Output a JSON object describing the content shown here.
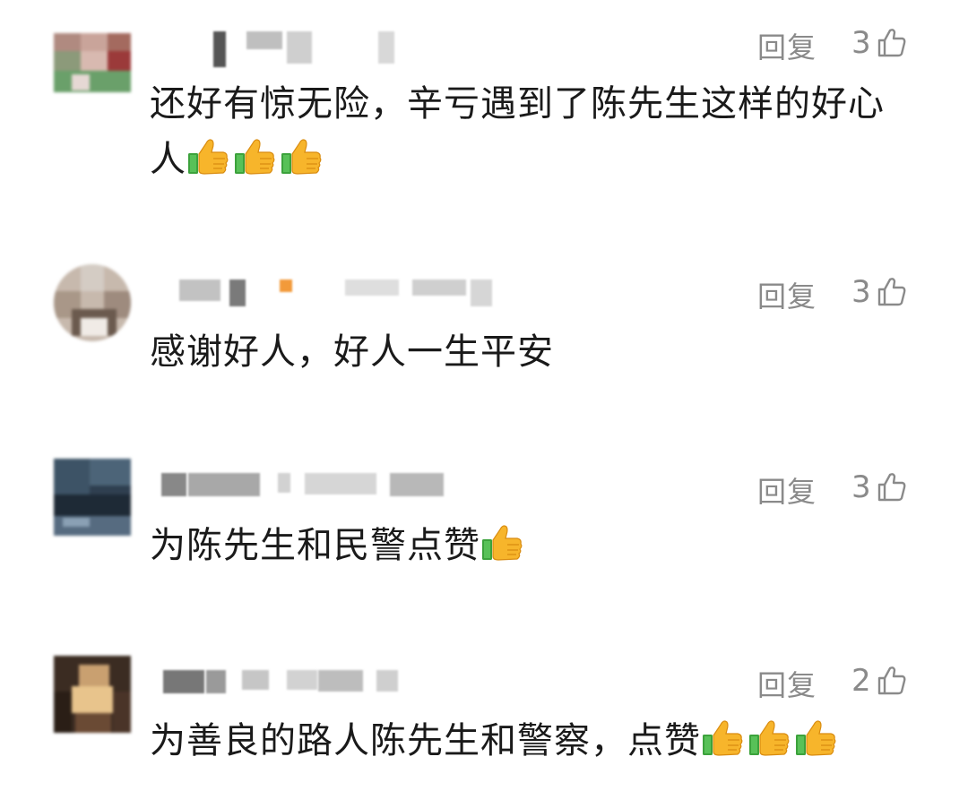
{
  "comments": [
    {
      "reply_label": "回复",
      "likes": "3",
      "text": "还好有惊无险，辛亏遇到了陈先生这样的好心人",
      "emoji": [
        "thumbs-up",
        "thumbs-up",
        "thumbs-up"
      ]
    },
    {
      "reply_label": "回复",
      "likes": "3",
      "text": "感谢好人，好人一生平安",
      "emoji": []
    },
    {
      "reply_label": "回复",
      "likes": "3",
      "text": "为陈先生和民警点赞",
      "emoji": [
        "thumbs-up"
      ]
    },
    {
      "reply_label": "回复",
      "likes": "2",
      "text": "为善良的路人陈先生和警察，点赞",
      "emoji": [
        "thumbs-up",
        "thumbs-up",
        "thumbs-up"
      ]
    }
  ],
  "colors": {
    "meta_text": "#8a8a8a",
    "body_text": "#1a1a1a",
    "thumb_yellow": "#f7b52b",
    "cuff_green": "#3ca23c"
  }
}
